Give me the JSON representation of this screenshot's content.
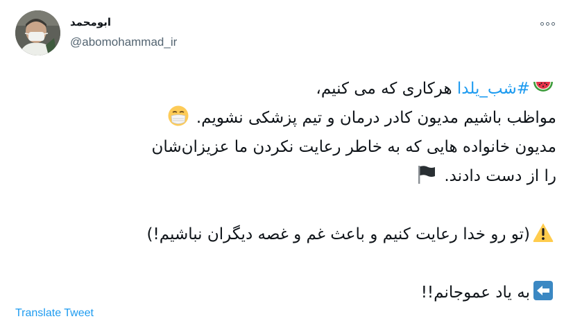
{
  "author": {
    "display_name": "ابومحمد",
    "handle": "@abomohammad_ir",
    "avatar": "avatar-photo"
  },
  "menu": {
    "icon": "more-horizontal-icon"
  },
  "tweet": {
    "line1_hashtag": "#شب_یلدا",
    "line1_text": " هرکاری که می کنیم،",
    "line2_text": "مواظب باشیم مدیون کادر درمان و تیم پزشکی نشویم.",
    "line3_text": "مدیون خانواده هایی که به خاطر رعایت نکردن ما عزیزان‌شان",
    "line4_text": "را از دست دادند.",
    "line5_text": "(تو رو خدا رعایت کنیم و باعث غم و غصه دیگران نباشیم!)",
    "line6_text": "به یاد عموجانم!!",
    "emojis": [
      "watermelon-icon",
      "face-with-mask-icon",
      "black-flag-icon",
      "warning-icon",
      "left-arrow-icon"
    ]
  },
  "translate_label": "Translate Tweet",
  "colors": {
    "link": "#1d9bf0",
    "text": "#0f1419",
    "muted": "#536471"
  }
}
